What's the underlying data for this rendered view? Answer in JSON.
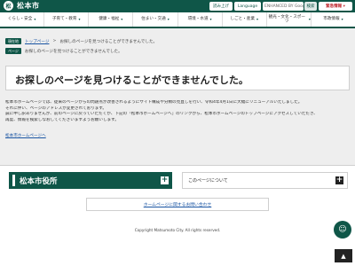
{
  "header": {
    "logo_mark": "松",
    "logo_text": "松本市",
    "reading_label": "読み上げ",
    "language_label": "Language",
    "search_placeholder": "ENHANCED BY Google",
    "search_button": "検索",
    "emergency_label": "緊急情報 ▾"
  },
  "nav": {
    "items": [
      {
        "label": "くらし・安全",
        "caret": "▾"
      },
      {
        "label": "子育て・教育",
        "caret": "▾"
      },
      {
        "label": "健康・福祉",
        "caret": "▾"
      },
      {
        "label": "住まい・交通",
        "caret": "▾"
      },
      {
        "label": "環境・水道",
        "caret": "▾"
      },
      {
        "label": "しごと・産業",
        "caret": "▾"
      },
      {
        "label": "観光・文化・スポーツ",
        "caret": "▾"
      },
      {
        "label": "市政情報",
        "caret": "▾"
      }
    ]
  },
  "breadcrumb": {
    "tag1": "現在地",
    "home": "トップページ",
    "sep": ">",
    "current": "お探しのページを見つけることができませんでした。",
    "tag2": "ページ",
    "current2": "お探しのページを見つけることができませんでした。"
  },
  "main": {
    "title": "お探しのページを見つけることができませんでした。",
    "paragraphs": [
      "松本市ホームページでは、従来のページからの問題点が改善されるようにサイト構成や分類の見直しを行い、令和4年4月1日に大幅にリニューアルいたしました。",
      "それに伴い、ページのアドレスが変更されております。",
      "誠に申し訳ありませんが、前のページに戻っていただくか、下記の「松本市ホームページへ」のリンクから、松本市ホームページのトップページにアクセスしていただき、",
      "再度、情報を検索しなおしてくださいますようお願いします。"
    ],
    "home_link": "松本市ホームページへ"
  },
  "footer": {
    "city_label": "松本市役所",
    "plus": "+",
    "about_label": "このページについて",
    "link_label": "ホームページに関するお問い合わせ",
    "copyright": "Copyright Matsumoto City. All rights reserved.",
    "chat_icon": "☺",
    "top_icon": "▲"
  }
}
